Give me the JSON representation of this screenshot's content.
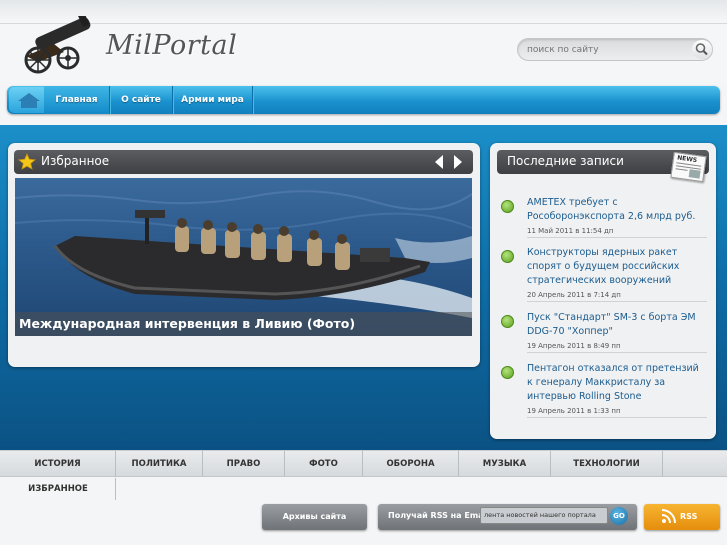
{
  "header": {
    "logo_text": "MilPortal",
    "search_placeholder": "поиск по сайту"
  },
  "nav": {
    "items": [
      {
        "label": "Главная"
      },
      {
        "label": "О сайте"
      },
      {
        "label": "Армии мира"
      }
    ]
  },
  "featured": {
    "title": "Избранное",
    "caption": "Международная интервенция в Ливию (Фото)"
  },
  "recent": {
    "title": "Последние записи",
    "badge": "NEWS",
    "posts": [
      {
        "title": "AMETEX требует с Рособоронэкспорта 2,6 млрд руб.",
        "date": "11 Май 2011 в 11:54 дп"
      },
      {
        "title": "Конструкторы ядерных ракет спорят о будущем российских стратегических вооружений",
        "date": "20 Апрель 2011 в 7:14 дп"
      },
      {
        "title": "Пуск \"Стандарт\" SM-3 с борта ЭМ DDG-70 \"Хоппер\"",
        "date": "19 Апрель 2011 в 8:49 пп"
      },
      {
        "title": "Пентагон отказался от претензий к генералу Маккристалу за интервью Rolling Stone",
        "date": "19 Апрель 2011 в 1:33 пп"
      }
    ]
  },
  "categories": {
    "row1": [
      "ИСТОРИЯ",
      "ПОЛИТИКА",
      "ПРАВО",
      "ФОТО",
      "ОБОРОНА",
      "МУЗЫКА",
      "ТЕХНОЛОГИИ"
    ],
    "row2": [
      "ИЗБРАННОЕ"
    ]
  },
  "footer": {
    "archive_label": "Архивы сайта",
    "rss_email_label": "Получай RSS на Email",
    "feed_label": "лента новостей нашего портала",
    "go_label": "GO",
    "rss_label": "RSS"
  }
}
